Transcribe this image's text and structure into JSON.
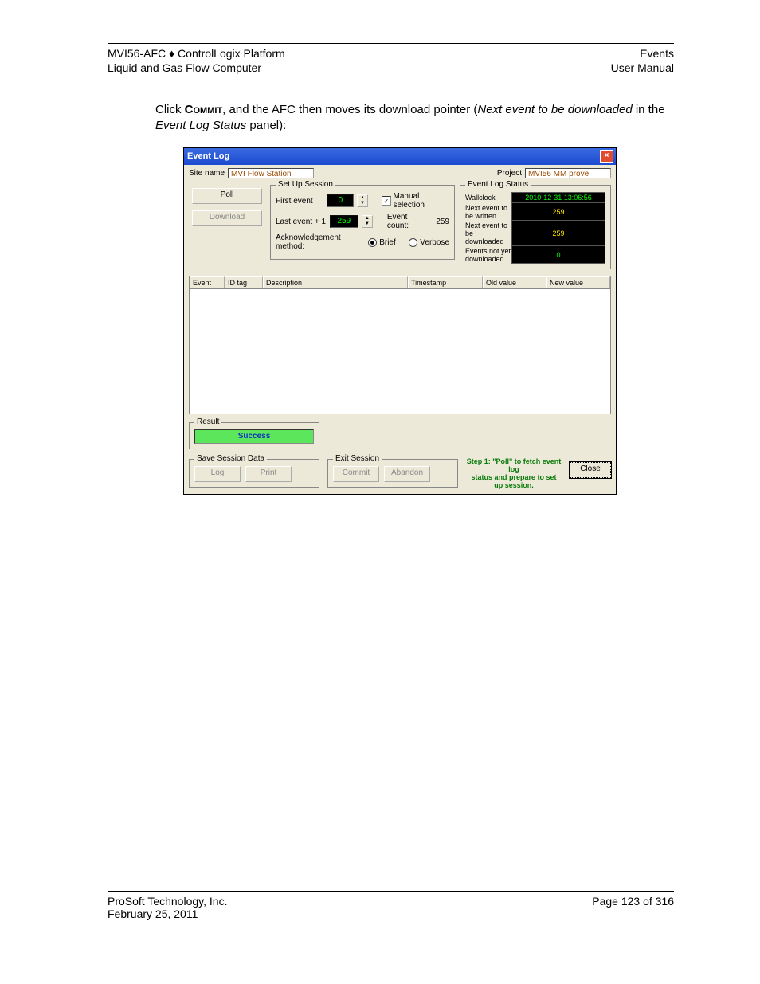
{
  "header": {
    "left1": "MVI56-AFC ♦ ControlLogix Platform",
    "left2": "Liquid and Gas Flow Computer",
    "right1": "Events",
    "right2": "User Manual"
  },
  "paragraph": {
    "p1a": "Click ",
    "p1b": "Commit",
    "p1c": ", and the AFC then moves its download pointer (",
    "p1d": "Next event to be downloaded",
    "p1e": " in the ",
    "p1f": "Event Log Status",
    "p1g": " panel):"
  },
  "dialog": {
    "title": "Event Log",
    "site_label": "Site name",
    "site_value": "MVI Flow Station",
    "project_label": "Project",
    "project_value": "MVI56 MM prove",
    "buttons": {
      "poll": "Poll",
      "download": "Download",
      "log": "Log",
      "print": "Print",
      "commit": "Commit",
      "abandon": "Abandon",
      "close": "Close"
    },
    "setup": {
      "legend": "Set Up Session",
      "first_event_label": "First event",
      "first_event_value": "0",
      "last_event_label": "Last event + 1",
      "last_event_value": "259",
      "manual_label": "Manual selection",
      "count_label": "Event count:",
      "count_value": "259",
      "ack_label": "Acknowledgement method:",
      "brief": "Brief",
      "verbose": "Verbose"
    },
    "status": {
      "legend": "Event Log Status",
      "wallclock_label": "Wallclock",
      "wallclock_value": "2010-12-31 13:06:56",
      "next_write_label": "Next event to be written",
      "next_write_value": "259",
      "next_dl_label": "Next event to be downloaded",
      "next_dl_value": "259",
      "not_dl_label": "Events not yet downloaded",
      "not_dl_value": "0"
    },
    "grid": {
      "event": "Event",
      "id": "ID tag",
      "desc": "Description",
      "ts": "Timestamp",
      "old": "Old value",
      "new": "New value"
    },
    "result": {
      "legend": "Result",
      "value": "Success"
    },
    "save_legend": "Save Session Data",
    "exit_legend": "Exit Session",
    "hint1": "Step 1: \"Poll\" to fetch event log",
    "hint2": "status and prepare to set up session."
  },
  "footer": {
    "company": "ProSoft Technology, Inc.",
    "date": "February 25, 2011",
    "page": "Page 123 of 316"
  }
}
